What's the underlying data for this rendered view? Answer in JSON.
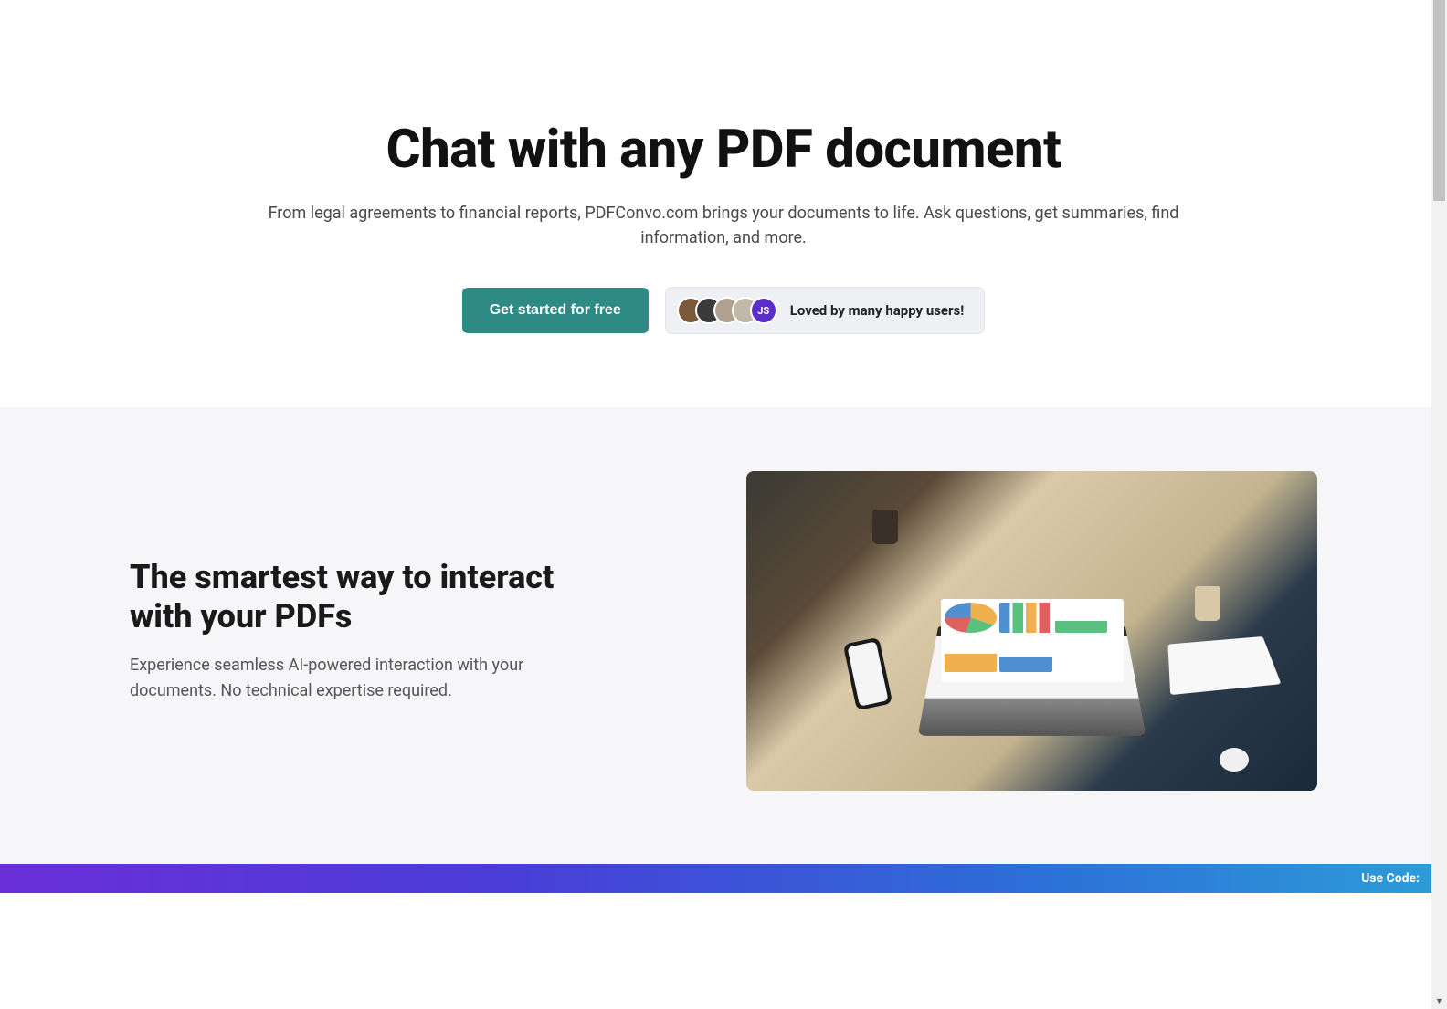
{
  "hero": {
    "title": "Chat with any PDF document",
    "subtitle": "From legal agreements to financial reports, PDFConvo.com brings your documents to life. Ask questions, get summaries, find information, and more.",
    "cta_label": "Get started for free",
    "social_proof_label": "Loved by many happy users!",
    "avatar_badge": "JS"
  },
  "feature": {
    "title": "The smartest way to interact with your PDFs",
    "description": "Experience seamless AI-powered interaction with your documents. No technical expertise required."
  },
  "promo": {
    "label": "Use Code:"
  }
}
